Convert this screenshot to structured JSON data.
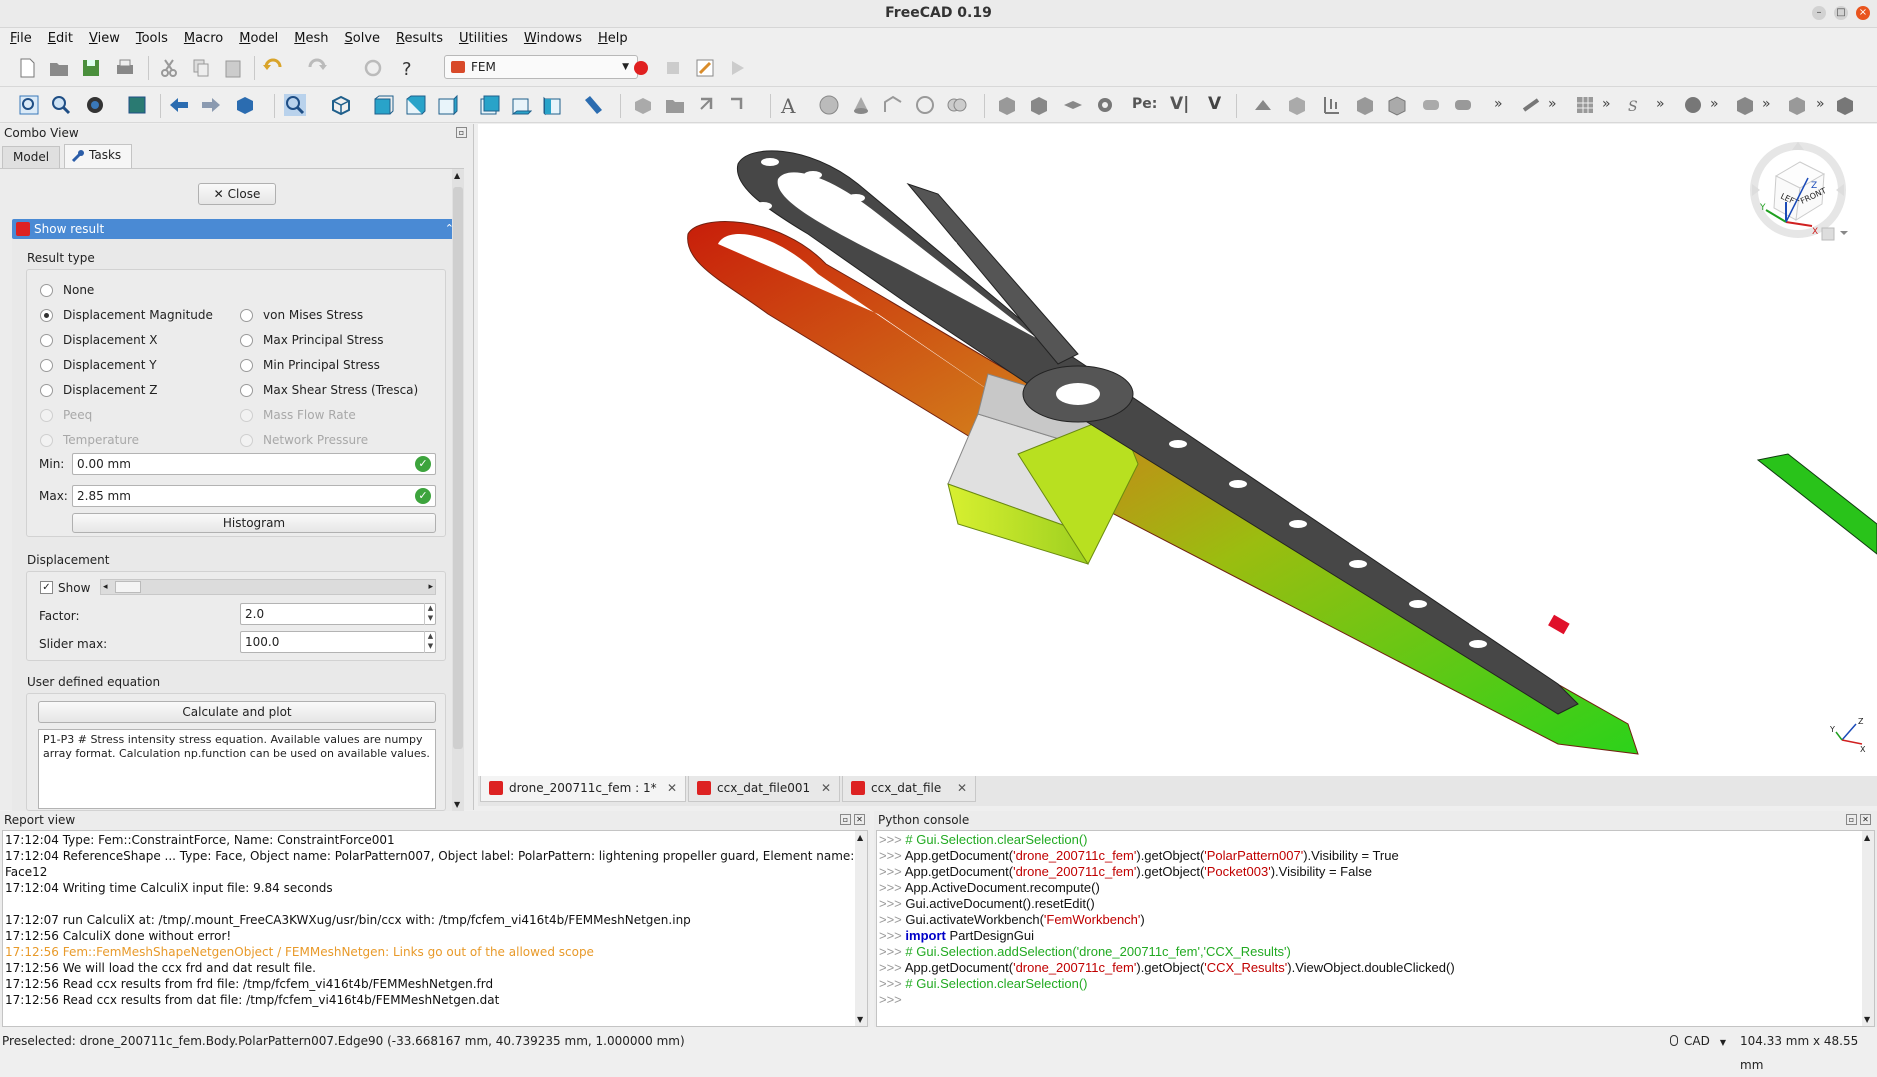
{
  "app": {
    "title": "FreeCAD 0.19"
  },
  "menu": [
    "File",
    "Edit",
    "View",
    "Tools",
    "Macro",
    "Model",
    "Mesh",
    "Solve",
    "Results",
    "Utilities",
    "Windows",
    "Help"
  ],
  "toolbar": {
    "workbench": "FEM",
    "text_pe": "Pe:",
    "text_v1": "V|",
    "text_v2": "V",
    "more": "»"
  },
  "combo": {
    "title": "Combo View",
    "tabs": [
      "Model",
      "Tasks"
    ],
    "close_label": "Close",
    "section_title": "Show result"
  },
  "result_type": {
    "label": "Result type",
    "left": [
      "None",
      "Displacement Magnitude",
      "Displacement X",
      "Displacement Y",
      "Displacement Z",
      "Peeq",
      "Temperature"
    ],
    "right": [
      "von Mises Stress",
      "Max Principal Stress",
      "Min Principal Stress",
      "Max Shear Stress (Tresca)",
      "Mass Flow Rate",
      "Network Pressure"
    ],
    "selected": "Displacement Magnitude"
  },
  "range": {
    "min_label": "Min:",
    "min_value": "0.00 mm",
    "max_label": "Max:",
    "max_value": "2.85 mm",
    "histogram_label": "Histogram"
  },
  "displacement": {
    "label": "Displacement",
    "show_label": "Show",
    "show_checked": true,
    "factor_label": "Factor:",
    "factor_value": "2.0",
    "slider_max_label": "Slider max:",
    "slider_max_value": "100.0"
  },
  "equation": {
    "label": "User defined equation",
    "calc_label": "Calculate and plot",
    "text": "P1-P3 # Stress intensity stress equation. Available values are numpy array format. Calculation np.function can be used on available values."
  },
  "doc_tabs": [
    "drone_200711c_fem : 1*",
    "ccx_dat_file001",
    "ccx_dat_file"
  ],
  "navcube": {
    "faces": [
      "LEFT",
      "FRONT"
    ],
    "axes": [
      "X",
      "Y",
      "Z"
    ]
  },
  "report": {
    "title": "Report view",
    "lines": [
      {
        "text": "17:12:04    Type: Fem::ConstraintForce, Name: ConstraintForce001",
        "color": "#111111"
      },
      {
        "text": "17:12:04    ReferenceShape ... Type: Face, Object name: PolarPattern007, Object label: PolarPattern: lightening propeller guard, Element name:",
        "color": "#111111"
      },
      {
        "text": "Face12",
        "color": "#111111"
      },
      {
        "text": "17:12:04  Writing time CalculiX input file: 9.84 seconds",
        "color": "#111111"
      },
      {
        "text": "",
        "color": "#111111"
      },
      {
        "text": "17:12:07  run CalculiX at: /tmp/.mount_FreeCA3KWXug/usr/bin/ccx with: /tmp/fcfem_vi416t4b/FEMMeshNetgen.inp",
        "color": "#111111"
      },
      {
        "text": "17:12:56  CalculiX done without error!",
        "color": "#111111"
      },
      {
        "text": "17:12:56  Fem::FemMeshShapeNetgenObject / FEMMeshNetgen: Links go out of the allowed scope",
        "color": "#e89a2a"
      },
      {
        "text": "17:12:56  We will load the ccx frd and dat result file.",
        "color": "#111111"
      },
      {
        "text": "17:12:56  Read ccx results from frd file: /tmp/fcfem_vi416t4b/FEMMeshNetgen.frd",
        "color": "#111111"
      },
      {
        "text": "17:12:56  Read ccx results from dat file: /tmp/fcfem_vi416t4b/FEMMeshNetgen.dat",
        "color": "#111111"
      }
    ]
  },
  "python": {
    "title": "Python console",
    "prompt": ">>>",
    "lines": [
      {
        "pre": "",
        "str": "",
        "post": "",
        "comment": "# Gui.Selection.clearSelection()"
      },
      {
        "pre": "App.getDocument(",
        "str": "'drone_200711c_fem'",
        "mid": ").getObject(",
        "str2": "'PolarPattern007'",
        "post": ").Visibility = True"
      },
      {
        "pre": "App.getDocument(",
        "str": "'drone_200711c_fem'",
        "mid": ").getObject(",
        "str2": "'Pocket003'",
        "post": ").Visibility = False"
      },
      {
        "pre": "App.ActiveDocument.recompute()",
        "str": "",
        "post": ""
      },
      {
        "pre": "Gui.activeDocument().resetEdit()",
        "str": "",
        "post": ""
      },
      {
        "pre": "Gui.activateWorkbench(",
        "str": "'FemWorkbench'",
        "post": ")"
      },
      {
        "kw": "import",
        "pre": " PartDesignGui",
        "str": "",
        "post": ""
      },
      {
        "comment": "# Gui.Selection.addSelection('drone_200711c_fem','CCX_Results')"
      },
      {
        "pre": "App.getDocument(",
        "str": "'drone_200711c_fem'",
        "mid": ").getObject(",
        "str2": "'CCX_Results'",
        "post": ").ViewObject.doubleClicked()"
      },
      {
        "comment": "# Gui.Selection.clearSelection()"
      },
      {
        "pre": "",
        "str": "",
        "post": ""
      }
    ]
  },
  "status": {
    "preselected": "Preselected: drone_200711c_fem.Body.PolarPattern007.Edge90 (-33.668167 mm, 40.739235 mm, 1.000000 mm)",
    "nav": "CAD",
    "dims": "104.33 mm x 48.55 mm"
  }
}
